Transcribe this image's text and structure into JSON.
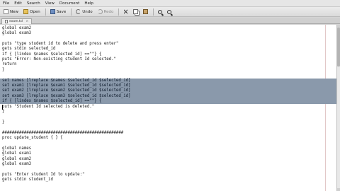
{
  "menu": [
    "File",
    "Edit",
    "Search",
    "View",
    "Document",
    "Help"
  ],
  "toolbar": {
    "new_label": "New",
    "open_label": "Open",
    "save_label": "Save",
    "undo_label": "Undo",
    "redo_label": "Redo"
  },
  "tab": {
    "label": "exam.tcl",
    "close": "×"
  },
  "editor": {
    "lines": [
      {
        "text": "global exam2",
        "selected": false
      },
      {
        "text": "global exam3",
        "selected": false
      },
      {
        "text": "",
        "selected": false
      },
      {
        "text": "puts \"type student id to delete and press enter\"",
        "selected": false
      },
      {
        "text": "gets stdin selected_id",
        "selected": false
      },
      {
        "text": "if { [lindex $names $selected_id] ==\"\"} {",
        "selected": false
      },
      {
        "text": "puts \"Error: Non-existing student Id selected.\"",
        "selected": false
      },
      {
        "text": "return",
        "selected": false
      },
      {
        "text": "}",
        "selected": false
      },
      {
        "text": "",
        "selected": false
      },
      {
        "text": "set names [lreplace $names $selected_id $selected_id]",
        "selected": true
      },
      {
        "text": "set exam1 [lreplace $exam1 $selected_id $selected_id]",
        "selected": true
      },
      {
        "text": "set exam2 [lreplace $exam2 $selected_id $selected_id]",
        "selected": true
      },
      {
        "text": "set exam3 [lreplace $exam3 $selected_id $selected_id]",
        "selected": true
      },
      {
        "text": "if { [lindex $names $selected_id] ==\"\"} {",
        "selected": true
      },
      {
        "text": "puts \"Student Id selected is deleted.\"",
        "selected": false
      },
      {
        "text": "}",
        "selected": false
      },
      {
        "text": "",
        "selected": false
      },
      {
        "text": "}",
        "selected": false
      },
      {
        "text": "",
        "selected": false
      },
      {
        "text": "##################################################",
        "selected": false
      },
      {
        "text": "proc update_student { } {",
        "selected": false
      },
      {
        "text": "",
        "selected": false
      },
      {
        "text": "global names",
        "selected": false
      },
      {
        "text": "global exam1",
        "selected": false
      },
      {
        "text": "global exam2",
        "selected": false
      },
      {
        "text": "global exam3",
        "selected": false
      },
      {
        "text": "",
        "selected": false
      },
      {
        "text": "puts \"Enter student Id to update:\"",
        "selected": false
      },
      {
        "text": "gets stdin student_id",
        "selected": false
      },
      {
        "text": "",
        "selected": false
      },
      {
        "text": "",
        "selected": false
      }
    ]
  }
}
